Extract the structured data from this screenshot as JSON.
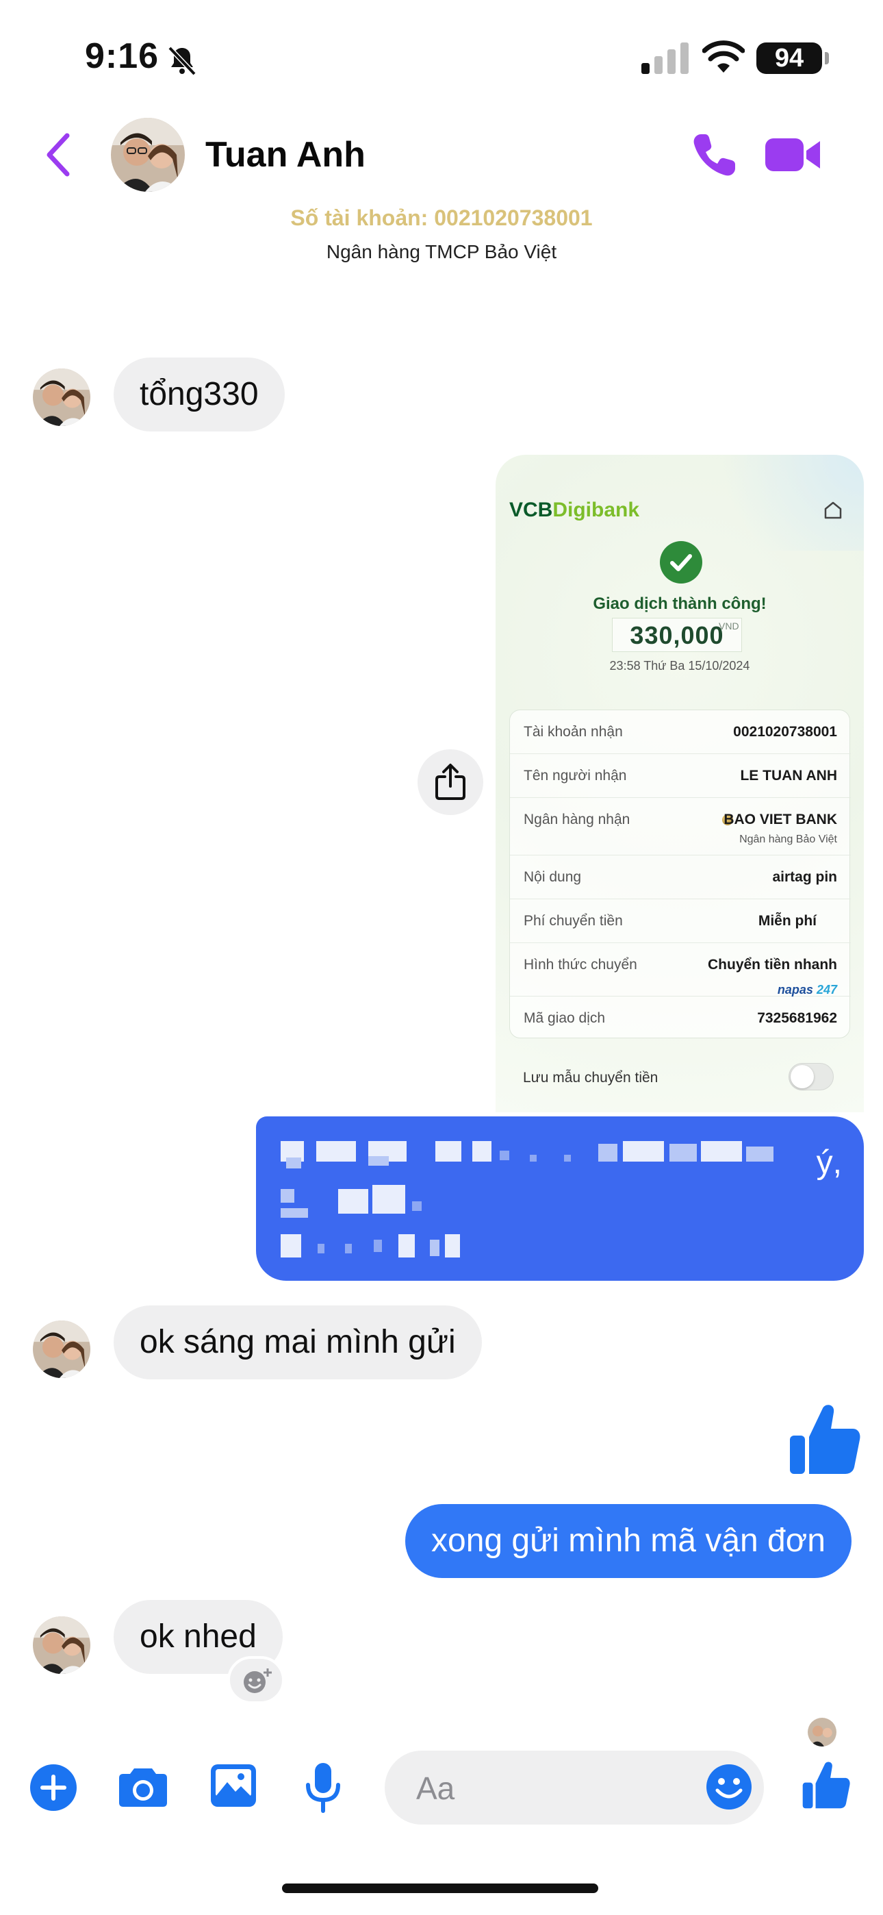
{
  "status_bar": {
    "time": "9:16",
    "battery": "94"
  },
  "header": {
    "contact_name": "Tuan Anh"
  },
  "pinned_image": {
    "account_line": "Số tài khoản: 0021020738001",
    "bank_line": "Ngân hàng TMCP Bảo Việt"
  },
  "messages": {
    "m1": "tổng330",
    "m2_blurred_tail": "ý,",
    "m3": "ok sáng mai mình gửi",
    "m4": "xong gửi mình mã vận đơn",
    "m5": "ok nhed"
  },
  "receipt": {
    "logo_a": "VCB",
    "logo_b": "Digibank",
    "title": "Giao dịch thành công!",
    "amount": "330,000",
    "currency": "VND",
    "datetime": "23:58 Thứ Ba 15/10/2024",
    "rows": [
      {
        "label": "Tài khoản nhận",
        "value": "0021020738001"
      },
      {
        "label": "Tên người nhận",
        "value": "LE TUAN ANH"
      },
      {
        "label": "Ngân hàng nhận",
        "value": "BAO VIET BANK",
        "sub": "Ngân hàng Bảo Việt"
      },
      {
        "label": "Nội dung",
        "value": "airtag pin"
      },
      {
        "label": "Phí chuyển tiền",
        "value": "Miễn phí"
      },
      {
        "label": "Hình thức chuyển",
        "value": "Chuyển tiền nhanh",
        "badge_a": "napas",
        "badge_b": "247"
      },
      {
        "label": "Mã giao dịch",
        "value": "7325681962"
      }
    ],
    "save_template": "Lưu mẫu chuyển tiền"
  },
  "composer": {
    "placeholder": "Aa"
  },
  "colors": {
    "accent": "#9b3cf0",
    "bubble_out": "#3178f6",
    "bubble_in": "#efeff0"
  }
}
